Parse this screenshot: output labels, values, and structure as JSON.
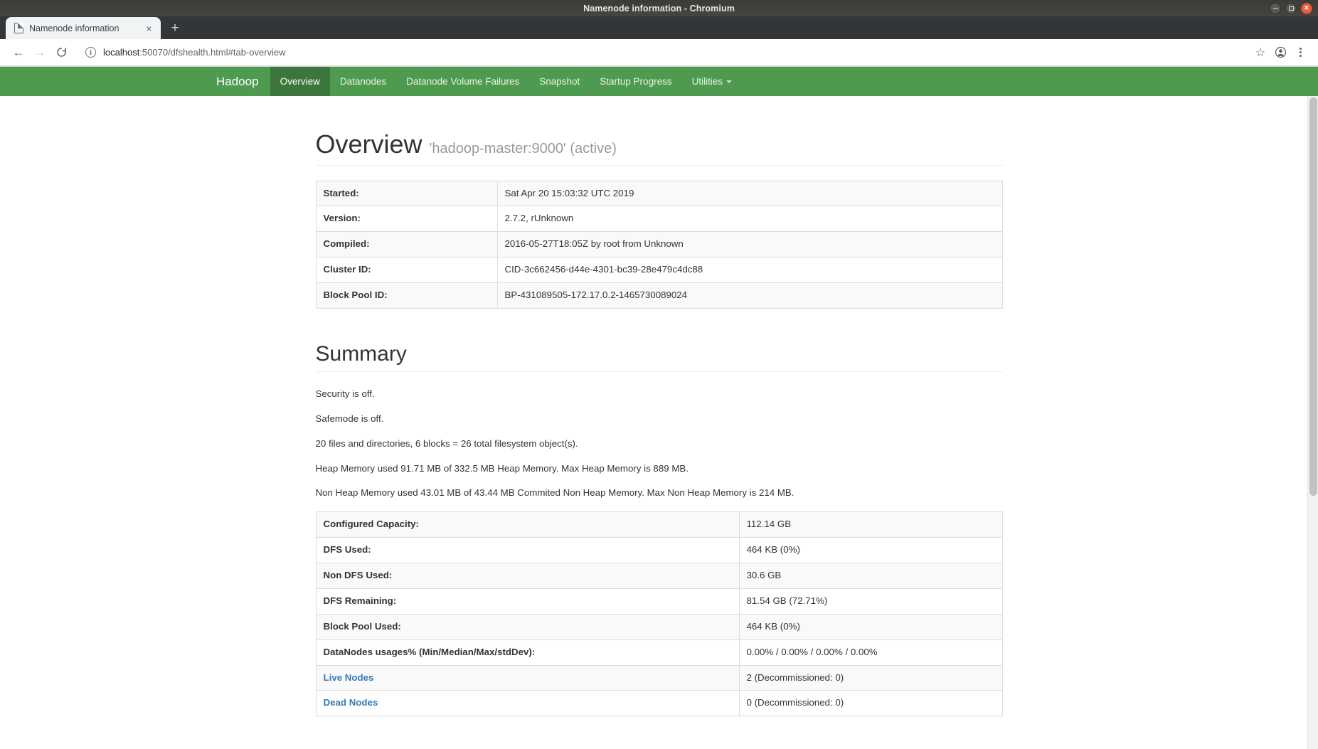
{
  "window": {
    "title": "Namenode information - Chromium",
    "controls": {
      "minimize": "minimize",
      "maximize": "maximize",
      "close": "close"
    }
  },
  "browser": {
    "tab": {
      "title": "Namenode information",
      "close_label": "×"
    },
    "new_tab_label": "+",
    "back_label": "←",
    "forward_label": "→",
    "reload_label": "reload",
    "omnibox": {
      "info_label": "i",
      "url_host": "localhost",
      "url_rest": ":50070/dfshealth.html#tab-overview",
      "full_url": "localhost:50070/dfshealth.html#tab-overview"
    },
    "star_label": "☆",
    "profile_label": "profile"
  },
  "hadoop_nav": {
    "brand": "Hadoop",
    "items": [
      {
        "label": "Overview",
        "active": true,
        "caret": false
      },
      {
        "label": "Datanodes",
        "active": false,
        "caret": false
      },
      {
        "label": "Datanode Volume Failures",
        "active": false,
        "caret": false
      },
      {
        "label": "Snapshot",
        "active": false,
        "caret": false
      },
      {
        "label": "Startup Progress",
        "active": false,
        "caret": false
      },
      {
        "label": "Utilities",
        "active": false,
        "caret": true
      }
    ],
    "accent_color": "#4e9a4e",
    "active_color": "#3d763d"
  },
  "overview": {
    "title": "Overview",
    "subtitle": "'hadoop-master:9000' (active)",
    "rows": [
      {
        "key": "Started:",
        "value": "Sat Apr 20 15:03:32 UTC 2019"
      },
      {
        "key": "Version:",
        "value": "2.7.2, rUnknown"
      },
      {
        "key": "Compiled:",
        "value": "2016-05-27T18:05Z by root from Unknown"
      },
      {
        "key": "Cluster ID:",
        "value": "CID-3c662456-d44e-4301-bc39-28e479c4dc88"
      },
      {
        "key": "Block Pool ID:",
        "value": "BP-431089505-172.17.0.2-1465730089024"
      }
    ]
  },
  "summary": {
    "title": "Summary",
    "notes": [
      "Security is off.",
      "Safemode is off.",
      "20 files and directories, 6 blocks = 26 total filesystem object(s).",
      "Heap Memory used 91.71 MB of 332.5 MB Heap Memory. Max Heap Memory is 889 MB.",
      "Non Heap Memory used 43.01 MB of 43.44 MB Commited Non Heap Memory. Max Non Heap Memory is 214 MB."
    ],
    "rows": [
      {
        "key": "Configured Capacity:",
        "value": "112.14 GB",
        "link": false
      },
      {
        "key": "DFS Used:",
        "value": "464 KB (0%)",
        "link": false
      },
      {
        "key": "Non DFS Used:",
        "value": "30.6 GB",
        "link": false
      },
      {
        "key": "DFS Remaining:",
        "value": "81.54 GB (72.71%)",
        "link": false
      },
      {
        "key": "Block Pool Used:",
        "value": "464 KB (0%)",
        "link": false
      },
      {
        "key": "DataNodes usages% (Min/Median/Max/stdDev):",
        "value": "0.00% / 0.00% / 0.00% / 0.00%",
        "link": false
      },
      {
        "key": "Live Nodes",
        "value": "2 (Decommissioned: 0)",
        "link": true
      },
      {
        "key": "Dead Nodes",
        "value": "0 (Decommissioned: 0)",
        "link": true
      }
    ],
    "link_color": "#337ab7"
  }
}
